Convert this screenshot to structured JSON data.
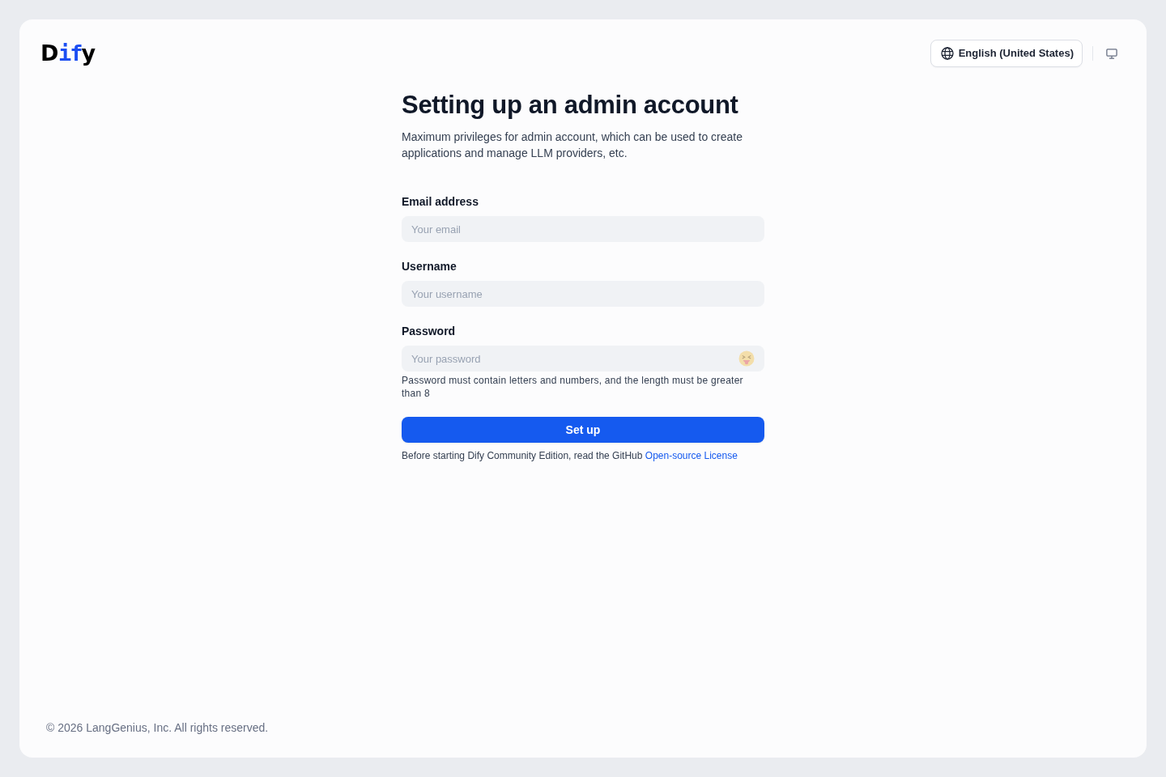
{
  "header": {
    "logo": {
      "parts": [
        {
          "text": "D",
          "accent": false
        },
        {
          "text": "if",
          "accent": true
        },
        {
          "text": "y",
          "accent": false
        }
      ]
    },
    "language_button": {
      "label": "English (United States)"
    }
  },
  "form": {
    "title": "Setting up an admin account",
    "description": "Maximum privileges for admin account, which can be used to create applications and manage LLM providers, etc.",
    "fields": [
      {
        "kind": "text",
        "label": "Email address",
        "placeholder": "Your email"
      },
      {
        "kind": "text",
        "label": "Username",
        "placeholder": "Your username"
      },
      {
        "kind": "password",
        "label": "Password",
        "placeholder": "Your password",
        "hint": "Password must contain letters and numbers, and the length must be greater than 8"
      }
    ],
    "submit_button": "Set up",
    "notice": {
      "text": "Before starting Dify Community Edition, read the GitHub",
      "link": "Open-source License"
    }
  },
  "footer": {
    "copyright": "© 2026 LangGenius, Inc. All rights reserved."
  }
}
